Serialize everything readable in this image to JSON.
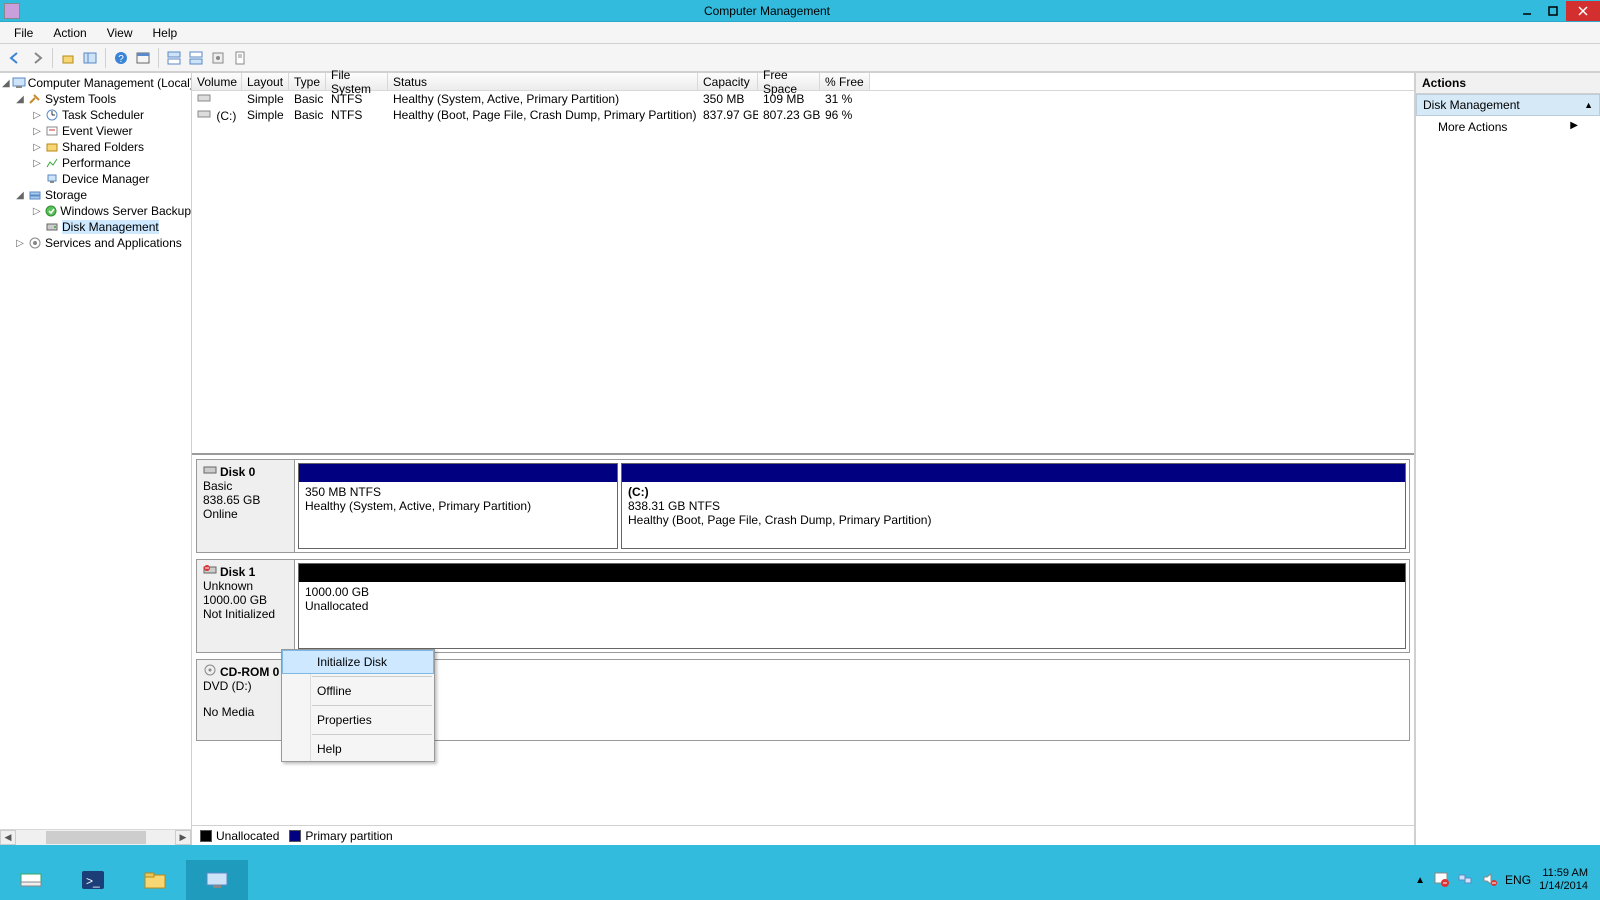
{
  "title": "Computer Management",
  "menu": [
    "File",
    "Action",
    "View",
    "Help"
  ],
  "tree": {
    "root": "Computer Management (Local)",
    "system_tools": "System Tools",
    "task_sched": "Task Scheduler",
    "event_viewer": "Event Viewer",
    "shared_folders": "Shared Folders",
    "performance": "Performance",
    "device_mgr": "Device Manager",
    "storage": "Storage",
    "ws_backup": "Windows Server Backup",
    "disk_mgmt": "Disk Management",
    "services": "Services and Applications"
  },
  "vol_headers": {
    "volume": "Volume",
    "layout": "Layout",
    "type": "Type",
    "fs": "File System",
    "status": "Status",
    "capacity": "Capacity",
    "free": "Free Space",
    "pfree": "% Free"
  },
  "vols": [
    {
      "volume": "",
      "layout": "Simple",
      "type": "Basic",
      "fs": "NTFS",
      "status": "Healthy (System, Active, Primary Partition)",
      "capacity": "350 MB",
      "free": "109 MB",
      "pfree": "31 %"
    },
    {
      "volume": "(C:)",
      "layout": "Simple",
      "type": "Basic",
      "fs": "NTFS",
      "status": "Healthy (Boot, Page File, Crash Dump, Primary Partition)",
      "capacity": "837.97 GB",
      "free": "807.23 GB",
      "pfree": "96 %"
    }
  ],
  "disks": {
    "d0": {
      "name": "Disk 0",
      "type": "Basic",
      "size": "838.65 GB",
      "state": "Online"
    },
    "d0p0": {
      "name": "",
      "size": "350 MB NTFS",
      "status": "Healthy (System, Active, Primary Partition)"
    },
    "d0p1": {
      "name": "(C:)",
      "size": "838.31 GB NTFS",
      "status": "Healthy (Boot, Page File, Crash Dump, Primary Partition)"
    },
    "d1": {
      "name": "Disk 1",
      "type": "Unknown",
      "size": "1000.00 GB",
      "state": "Not Initialized"
    },
    "d1p0": {
      "size": "1000.00 GB",
      "status": "Unallocated"
    },
    "cd": {
      "name": "CD-ROM 0",
      "type": "DVD (D:)",
      "state": "No Media"
    }
  },
  "legend": {
    "unalloc": "Unallocated",
    "primary": "Primary partition"
  },
  "actions": {
    "header": "Actions",
    "dm": "Disk Management",
    "more": "More Actions"
  },
  "context": {
    "init": "Initialize Disk",
    "offline": "Offline",
    "props": "Properties",
    "help": "Help"
  },
  "tray": {
    "lang": "ENG",
    "time": "11:59 AM",
    "date": "1/14/2014"
  }
}
